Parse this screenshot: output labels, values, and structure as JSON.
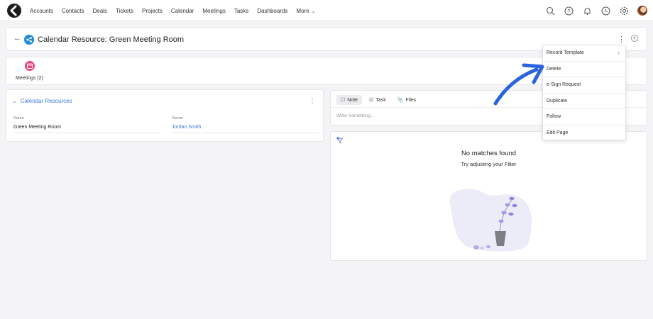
{
  "nav": {
    "links": [
      "Accounts",
      "Contacts",
      "Deals",
      "Tickets",
      "Projects",
      "Calendar",
      "Meetings",
      "Tasks",
      "Dashboards"
    ],
    "more_label": "More",
    "icons": [
      "search-icon",
      "help-icon",
      "bell-icon",
      "clock-icon",
      "gear-icon",
      "avatar"
    ]
  },
  "header": {
    "title": "Calendar Resource: Green Meeting Room"
  },
  "related": {
    "meetings_label": "Meetings (2)"
  },
  "section": {
    "title": "Calendar Resources",
    "fields": [
      {
        "label": "Name",
        "value": "Green Meeting Room"
      },
      {
        "label": "Owner",
        "value": "Jordan Smith"
      }
    ]
  },
  "composer": {
    "tabs": [
      "Note",
      "Task",
      "Files"
    ],
    "placeholder": "Write Something..."
  },
  "empty_state": {
    "title": "No matches found",
    "subtitle": "Try adjusting your Filter"
  },
  "menu": {
    "items": [
      "Record Template",
      "Delete",
      "e-Sign Request",
      "Duplicate",
      "Follow",
      "Edit Page"
    ]
  },
  "colors": {
    "accent": "#3c7be0",
    "meetings_badge": "#e9467a",
    "resource_icon": "#1d8bd6",
    "annotation_arrow": "#2a63e0"
  }
}
